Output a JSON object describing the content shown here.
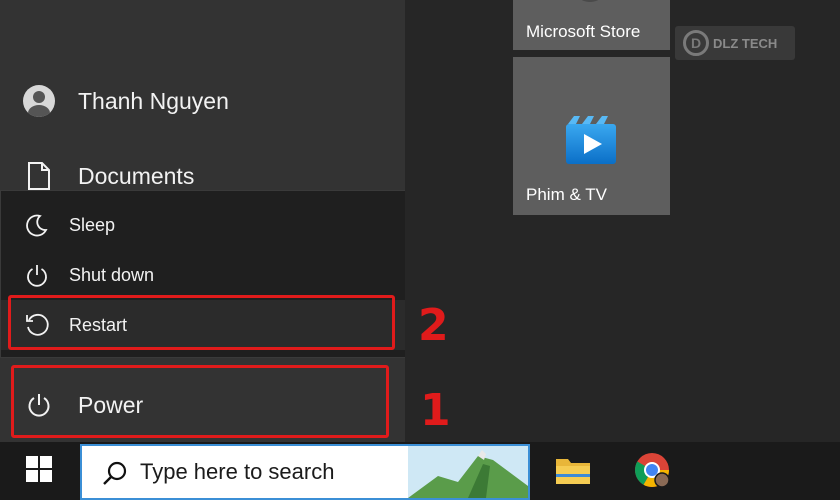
{
  "start_menu": {
    "user": {
      "name": "Thanh Nguyen",
      "icon": "user-avatar-icon"
    },
    "documents": {
      "label": "Documents",
      "icon": "document-icon"
    },
    "power_menu": {
      "items": [
        {
          "label": "Sleep",
          "icon": "moon-icon"
        },
        {
          "label": "Shut down",
          "icon": "power-icon"
        },
        {
          "label": "Restart",
          "icon": "restart-icon"
        }
      ]
    },
    "power": {
      "label": "Power",
      "icon": "power-icon"
    }
  },
  "tiles": [
    {
      "label": "Microsoft Store",
      "icon": "store-icon"
    },
    {
      "label": "Phim & TV",
      "icon": "film-tv-icon"
    }
  ],
  "annotations": {
    "step_one": "1",
    "step_two": "2",
    "color": "#e01b1b"
  },
  "watermark": {
    "text": "DLZ TECH"
  },
  "taskbar": {
    "search_placeholder": "Type here to search",
    "icons": [
      "windows-logo-icon",
      "file-explorer-icon",
      "chrome-icon"
    ]
  },
  "colors": {
    "accent_border": "#3b8fd6",
    "tile_bg": "#5e5e5e",
    "menu_bg": "#333333",
    "flyout_bg": "#1f1f1f"
  }
}
